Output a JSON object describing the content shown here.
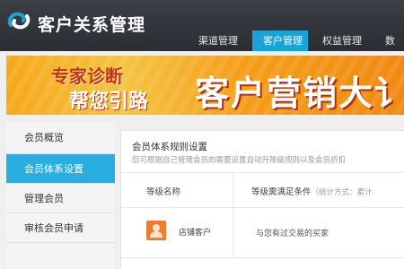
{
  "app": {
    "title": "客户关系管理",
    "accent_color": "#1aa3d6"
  },
  "nav": {
    "tabs": [
      {
        "label": "渠道管理",
        "active": false
      },
      {
        "label": "客户管理",
        "active": true
      },
      {
        "label": "权益管理",
        "active": false
      },
      {
        "label": "数",
        "active": false
      }
    ]
  },
  "banner": {
    "line1": "专家诊断",
    "line2": "帮您引路",
    "main": "客户营销大讠"
  },
  "sidebar": {
    "items": [
      {
        "label": "会员概览",
        "active": false
      },
      {
        "label": "会员体系设置",
        "active": true
      },
      {
        "label": "管理会员",
        "active": false
      },
      {
        "label": "审核会员申请",
        "active": false
      }
    ]
  },
  "main": {
    "title": "会员体系规则设置",
    "description": "您可根据自己管理会员的需要设置自动升降级规则以及会员折扣",
    "table": {
      "headers": {
        "level_name": "等级名称",
        "condition": "等级需满足条件",
        "condition_note": "（统计方式：累计"
      },
      "rows": [
        {
          "icon": "customer-avatar-icon",
          "name": "店铺客户",
          "condition": "与您有过交易的买家"
        }
      ]
    }
  }
}
